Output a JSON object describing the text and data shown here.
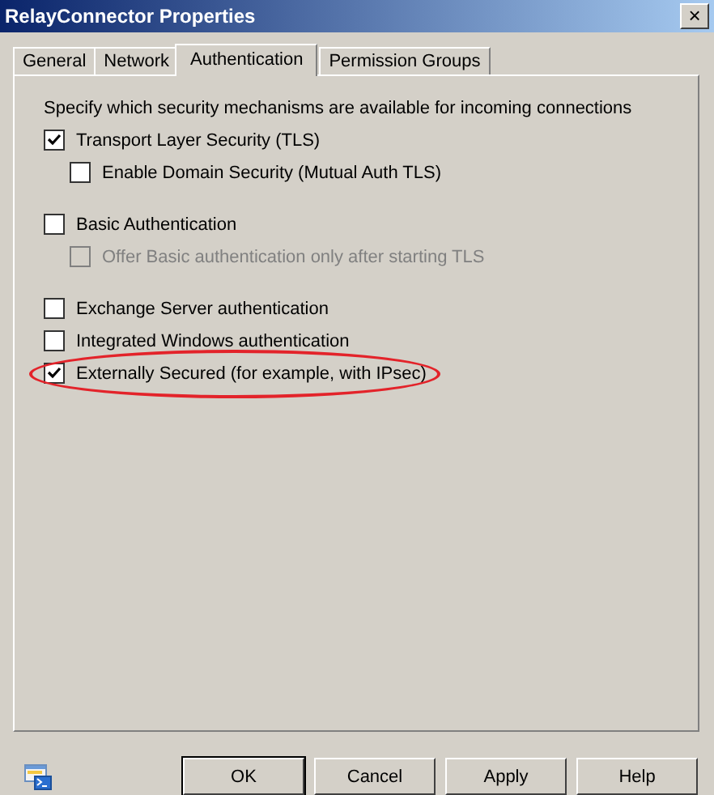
{
  "window": {
    "title": "RelayConnector Properties",
    "close": "×"
  },
  "tabs": [
    {
      "label": "General",
      "selected": false
    },
    {
      "label": "Network",
      "selected": false
    },
    {
      "label": "Authentication",
      "selected": true
    },
    {
      "label": "Permission Groups",
      "selected": false
    }
  ],
  "description": "Specify which security mechanisms are available for incoming connections",
  "groups": [
    {
      "options": [
        {
          "label": "Transport Layer Security (TLS)",
          "checked": true,
          "disabled": false,
          "highlighted": false,
          "children": [
            {
              "label": "Enable Domain Security (Mutual Auth TLS)",
              "checked": false,
              "disabled": false,
              "highlighted": false
            }
          ]
        }
      ]
    },
    {
      "options": [
        {
          "label": "Basic Authentication",
          "checked": false,
          "disabled": false,
          "highlighted": false,
          "children": [
            {
              "label": "Offer Basic authentication only after starting TLS",
              "checked": false,
              "disabled": true,
              "highlighted": false
            }
          ]
        }
      ]
    },
    {
      "options": [
        {
          "label": "Exchange Server authentication",
          "checked": false,
          "disabled": false,
          "highlighted": false
        },
        {
          "label": "Integrated Windows authentication",
          "checked": false,
          "disabled": false,
          "highlighted": false
        },
        {
          "label": "Externally Secured (for example, with IPsec)",
          "checked": true,
          "disabled": false,
          "highlighted": true
        }
      ]
    }
  ],
  "buttons": [
    {
      "label": "OK",
      "default": true
    },
    {
      "label": "Cancel",
      "default": false
    },
    {
      "label": "Apply",
      "default": false
    },
    {
      "label": "Help",
      "default": false
    }
  ]
}
